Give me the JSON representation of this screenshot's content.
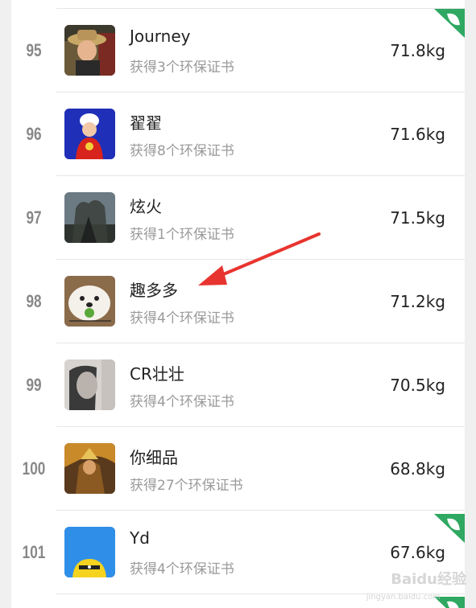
{
  "rows": [
    {
      "rank": "95",
      "name": "Journey",
      "certs": "获得3个环保证书",
      "weight": "71.8kg",
      "avatar": "photo-man-hat"
    },
    {
      "rank": "96",
      "name": "翟翟",
      "certs": "获得8个环保证书",
      "weight": "71.6kg",
      "avatar": "cartoon-chef"
    },
    {
      "rank": "97",
      "name": "炫火",
      "certs": "获得1个环保证书",
      "weight": "71.5kg",
      "avatar": "tree-silhouette"
    },
    {
      "rank": "98",
      "name": "趣多多",
      "certs": "获得4个环保证书",
      "weight": "71.2kg",
      "avatar": "white-dog"
    },
    {
      "rank": "99",
      "name": "CR壮壮",
      "certs": "获得4个环保证书",
      "weight": "70.5kg",
      "avatar": "gray-portrait"
    },
    {
      "rank": "100",
      "name": "你细品",
      "certs": "获得27个环保证书",
      "weight": "68.8kg",
      "avatar": "game-warrior"
    },
    {
      "rank": "101",
      "name": "Yd",
      "certs": "获得4个环保证书",
      "weight": "67.6kg",
      "avatar": "blue-cartoon"
    }
  ],
  "colors": {
    "badge_green": "#2fa862",
    "arrow_red": "#e8342f"
  },
  "watermark": {
    "brand": "Baidu经验",
    "url": "jingyan.baidu.com"
  }
}
